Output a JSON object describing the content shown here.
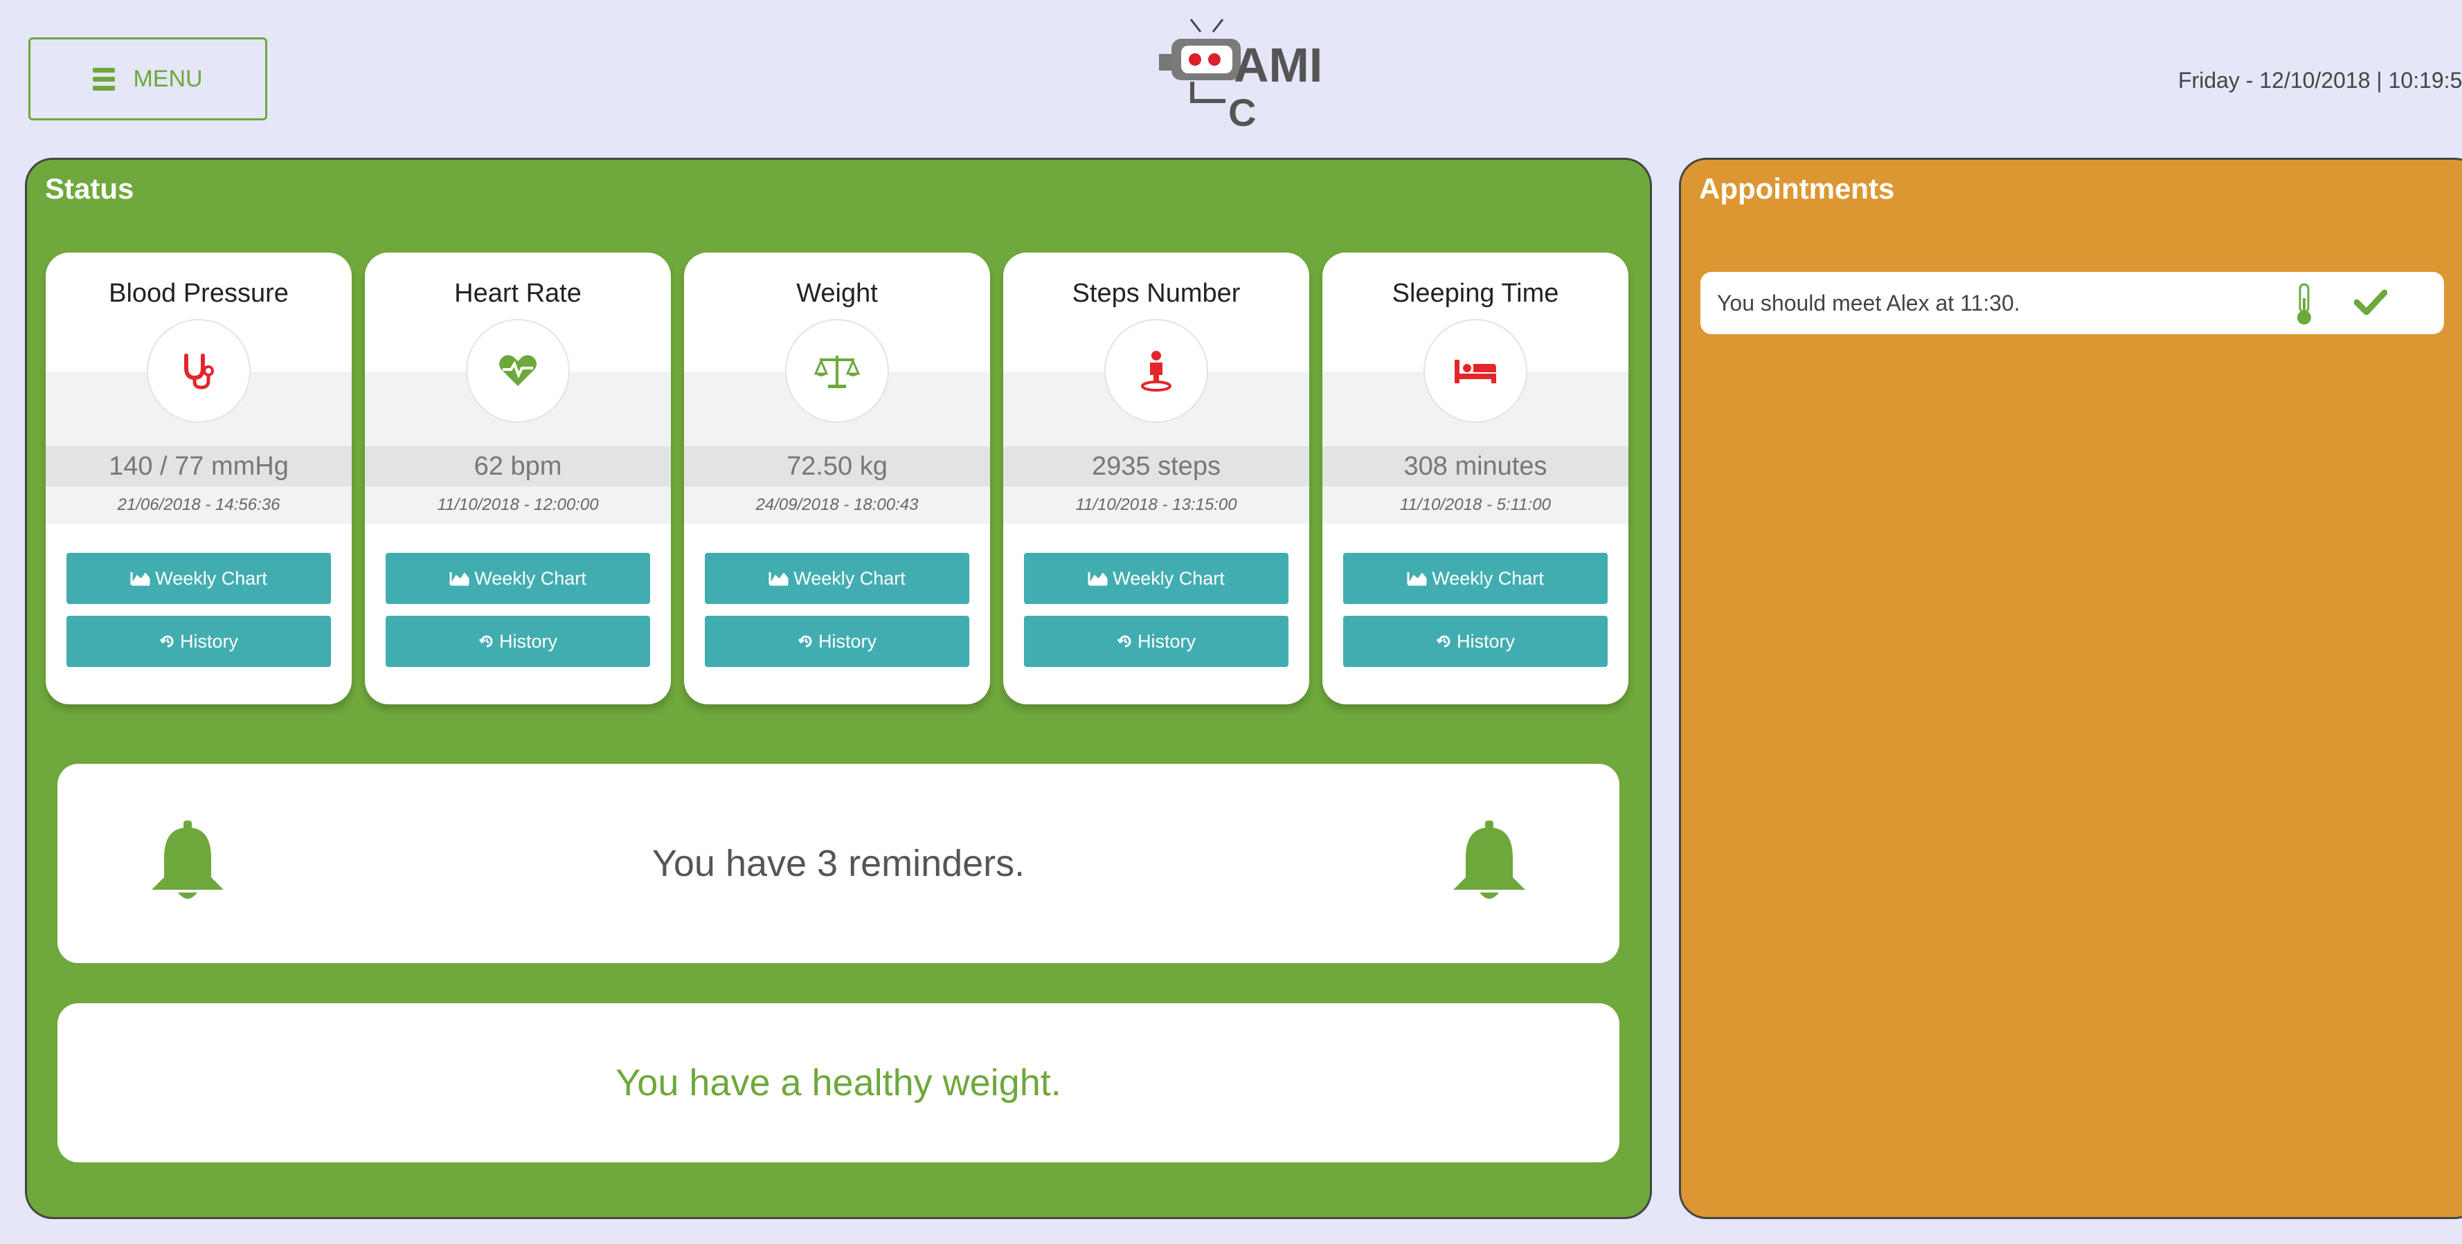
{
  "header": {
    "menu_label": "MENU",
    "logo_text": "AMI",
    "logo_sub": "C",
    "datetime": "Friday - 12/10/2018 | 10:19:5"
  },
  "status": {
    "title": "Status",
    "cards": [
      {
        "title": "Blood Pressure",
        "value": "140 / 77 mmHg",
        "timestamp": "21/06/2018 - 14:56:36",
        "icon": "stethoscope-icon",
        "weekly_label": "Weekly Chart",
        "history_label": "History"
      },
      {
        "title": "Heart Rate",
        "value": "62 bpm",
        "timestamp": "11/10/2018 - 12:00:00",
        "icon": "heartbeat-icon",
        "weekly_label": "Weekly Chart",
        "history_label": "History"
      },
      {
        "title": "Weight",
        "value": "72.50 kg",
        "timestamp": "24/09/2018 - 18:00:43",
        "icon": "balance-scale-icon",
        "weekly_label": "Weekly Chart",
        "history_label": "History"
      },
      {
        "title": "Steps Number",
        "value": "2935 steps",
        "timestamp": "11/10/2018 - 13:15:00",
        "icon": "person-steps-icon",
        "weekly_label": "Weekly Chart",
        "history_label": "History"
      },
      {
        "title": "Sleeping Time",
        "value": "308 minutes",
        "timestamp": "11/10/2018 - 5:11:00",
        "icon": "bed-icon",
        "weekly_label": "Weekly Chart",
        "history_label": "History"
      }
    ],
    "reminders_text": "You have 3 reminders.",
    "weight_message": "You have a healthy weight."
  },
  "appointments": {
    "title": "Appointments",
    "items": [
      {
        "text": "You should meet Alex at 11:30."
      }
    ]
  },
  "colors": {
    "status_panel": "#6fa83c",
    "appointments_panel": "#dc9733",
    "button": "#42adb0",
    "alert_icon": "#e2262b",
    "page_bg": "#e5e6f8"
  }
}
